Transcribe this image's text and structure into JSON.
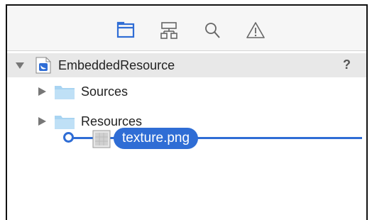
{
  "navigator": {
    "tabs": [
      {
        "name": "project-navigator",
        "icon": "folder-icon",
        "active": true
      },
      {
        "name": "symbol-navigator",
        "icon": "hierarchy-icon",
        "active": false
      },
      {
        "name": "find-navigator",
        "icon": "magnifier-icon",
        "active": false
      },
      {
        "name": "issue-navigator",
        "icon": "warning-triangle-icon",
        "active": false
      }
    ]
  },
  "tree": {
    "root": {
      "label": "EmbeddedResource",
      "icon": "swift-package-icon",
      "expanded": true,
      "status": "?"
    },
    "children": [
      {
        "label": "Sources",
        "icon": "folder-icon",
        "expanded": false
      },
      {
        "label": "Resources",
        "icon": "folder-icon",
        "expanded": false
      }
    ]
  },
  "drag": {
    "label": "texture.png",
    "icon": "image-file-icon"
  },
  "colors": {
    "accent": "#2f6dd5",
    "folder": "#a8d4f2",
    "selection": "#e8e8e8"
  }
}
